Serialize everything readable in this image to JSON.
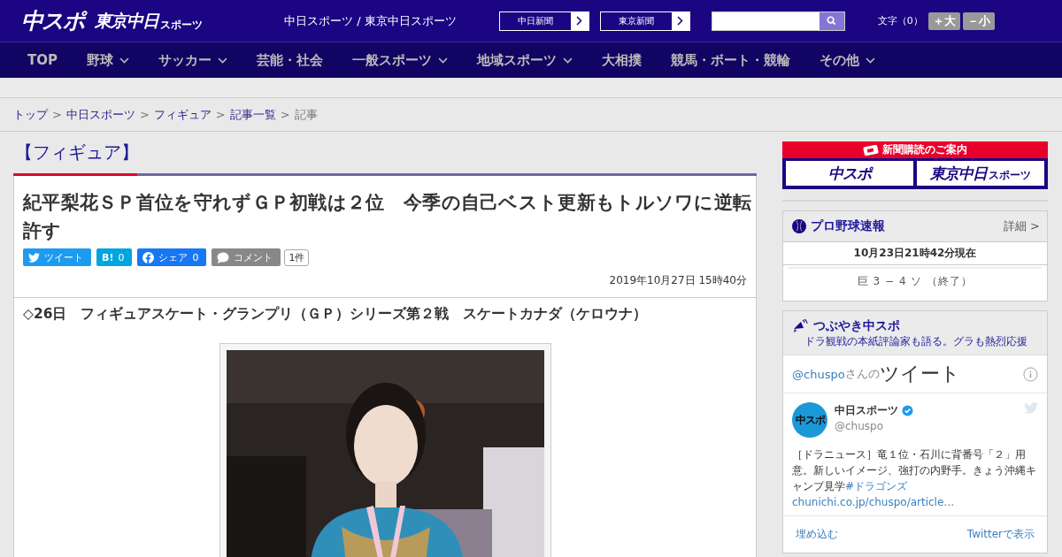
{
  "header": {
    "logo_main": "中スポ",
    "logo_tokyo": "東京中日",
    "logo_tokyo_sub": "スポーツ",
    "site_title": "中日スポーツ / 東京中日スポーツ",
    "paper_links": [
      "中日新聞",
      "東京新聞"
    ],
    "font_size": {
      "label": "文字（0）",
      "buttons": [
        "＋大",
        "－小"
      ]
    }
  },
  "nav": [
    {
      "label": "TOP",
      "dropdown": false
    },
    {
      "label": "野球",
      "dropdown": true
    },
    {
      "label": "サッカー",
      "dropdown": true
    },
    {
      "label": "芸能・社会",
      "dropdown": false
    },
    {
      "label": "一般スポーツ",
      "dropdown": true
    },
    {
      "label": "地域スポーツ",
      "dropdown": true
    },
    {
      "label": "大相撲",
      "dropdown": false
    },
    {
      "label": "競馬・ボート・競輪",
      "dropdown": false
    },
    {
      "label": "その他",
      "dropdown": true
    }
  ],
  "breadcrumb": [
    {
      "kind": "link",
      "label": "トップ"
    },
    {
      "kind": "separator",
      "label": ">"
    },
    {
      "kind": "link",
      "label": "中日スポーツ"
    },
    {
      "kind": "separator",
      "label": ">"
    },
    {
      "kind": "link",
      "label": "フィギュア"
    },
    {
      "kind": "separator",
      "label": ">"
    },
    {
      "kind": "link",
      "label": "記事一覧"
    },
    {
      "kind": "separator",
      "label": ">"
    },
    {
      "kind": "current",
      "label": "記事"
    }
  ],
  "category": "【フィギュア】",
  "article": {
    "title": "紀平梨花ＳＰ首位を守れずＧＰ初戦は２位　今季の自己ベスト更新もトルソワに逆転許す",
    "share": [
      {
        "kind": "twitter",
        "label": "ツイート"
      },
      {
        "kind": "hatena",
        "label": "B!",
        "count": "0"
      },
      {
        "kind": "facebook",
        "label": "シェア",
        "count": "0"
      },
      {
        "kind": "comment",
        "label": "コメント",
        "count": "1件"
      }
    ],
    "date": "2019年10月27日 15時40分",
    "lead": "◇26日　フィギュアスケート・グランプリ（ＧＰ）シリーズ第２戦　スケートカナダ（ケロウナ）"
  },
  "sidebar": {
    "subscribe": {
      "title": "新聞購読のご案内",
      "logo_main": "中スポ",
      "logo_tokyo": "東京中日",
      "logo_tokyo_sub": "スポーツ"
    },
    "baseball": {
      "title": "プロ野球速報",
      "detail": "詳細 >",
      "updated": "10月23日21時42分現在",
      "games": [
        "巨 3 − 4 ソ （終了）"
      ]
    },
    "tweets": {
      "title": "つぶやき中スポ",
      "subtitle": "ドラ観戦の本紙評論家も語る。グラも熱烈応援",
      "account": "@chuspo",
      "account_suffix": "さんの",
      "heading": "ツイート",
      "tweet": {
        "avatar": "中スポ",
        "name": "中日スポーツ",
        "verified": true,
        "handle": "@chuspo",
        "text": "［ドラニュース］竜１位・石川に背番号「２」用意。新しいイメージ、強打の内野手。きょう沖縄キャンプ見学",
        "hashtag": "#ドラゴンズ",
        "link": "chunichi.co.jp/chuspo/article…"
      },
      "footer": [
        "埋め込む",
        "Twitterで表示"
      ]
    }
  }
}
